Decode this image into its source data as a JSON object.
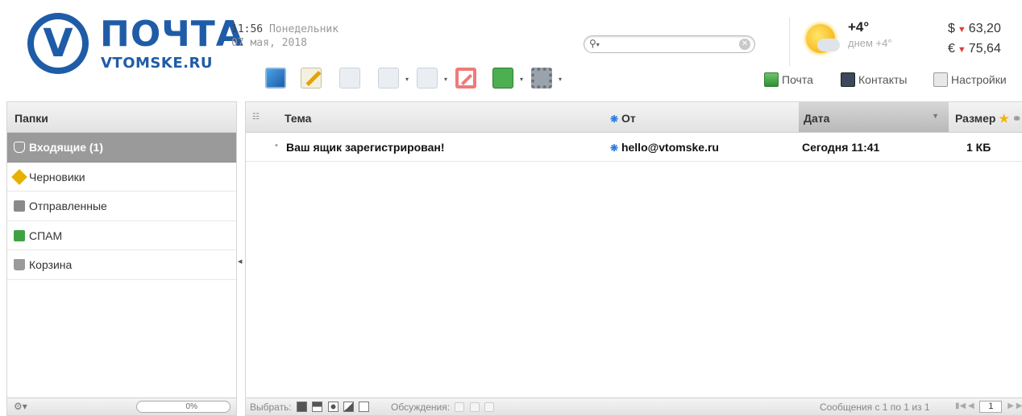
{
  "brand": {
    "logo_letter": "V",
    "title": "ПОЧТА",
    "subtitle": "VTOMSKE.RU"
  },
  "datetime": {
    "time": "11:56",
    "weekday": "Понедельник",
    "date": "07 мая, 2018"
  },
  "search": {
    "value": "",
    "placeholder": ""
  },
  "weather": {
    "icon": "sun-cloud-icon",
    "temp": "+4°",
    "day": "днем +4°"
  },
  "rates": [
    {
      "currency": "$",
      "trend": "down",
      "value": "63,20"
    },
    {
      "currency": "€",
      "trend": "down",
      "value": "75,64"
    }
  ],
  "toolbar": {
    "buttons": [
      "refresh-icon",
      "compose-icon",
      "reply-icon",
      "reply-all-icon",
      "forward-icon",
      "delete-icon",
      "spam-icon",
      "settings-gear-icon"
    ]
  },
  "nav": {
    "mail": "Почта",
    "contacts": "Контакты",
    "settings": "Настройки"
  },
  "folders": {
    "header": "Папки",
    "items": [
      {
        "label": "Входящие (1)",
        "icon": "inbox-icon",
        "active": true
      },
      {
        "label": "Черновики",
        "icon": "pencil-icon",
        "active": false
      },
      {
        "label": "Отправленные",
        "icon": "sent-icon",
        "active": false
      },
      {
        "label": "СПАМ",
        "icon": "spam-icon",
        "active": false
      },
      {
        "label": "Корзина",
        "icon": "trash-icon",
        "active": false
      }
    ],
    "quota": "0%"
  },
  "list": {
    "columns": {
      "subject": "Тема",
      "from": "От",
      "date": "Дата",
      "size": "Размер"
    },
    "rows": [
      {
        "subject": "Ваш ящик зарегистрирован!",
        "from": "hello@vtomske.ru",
        "date": "Сегодня 11:41",
        "size": "1 КБ"
      }
    ]
  },
  "footer": {
    "select_label": "Выбрать:",
    "threads_label": "Обсуждения:",
    "count": "Сообщения с 1 по 1 из 1",
    "page": "1"
  },
  "colors": {
    "brand_blue": "#1f5ca7",
    "active_folder": "#9a9a9a",
    "rate_down": "#e53a3a"
  }
}
